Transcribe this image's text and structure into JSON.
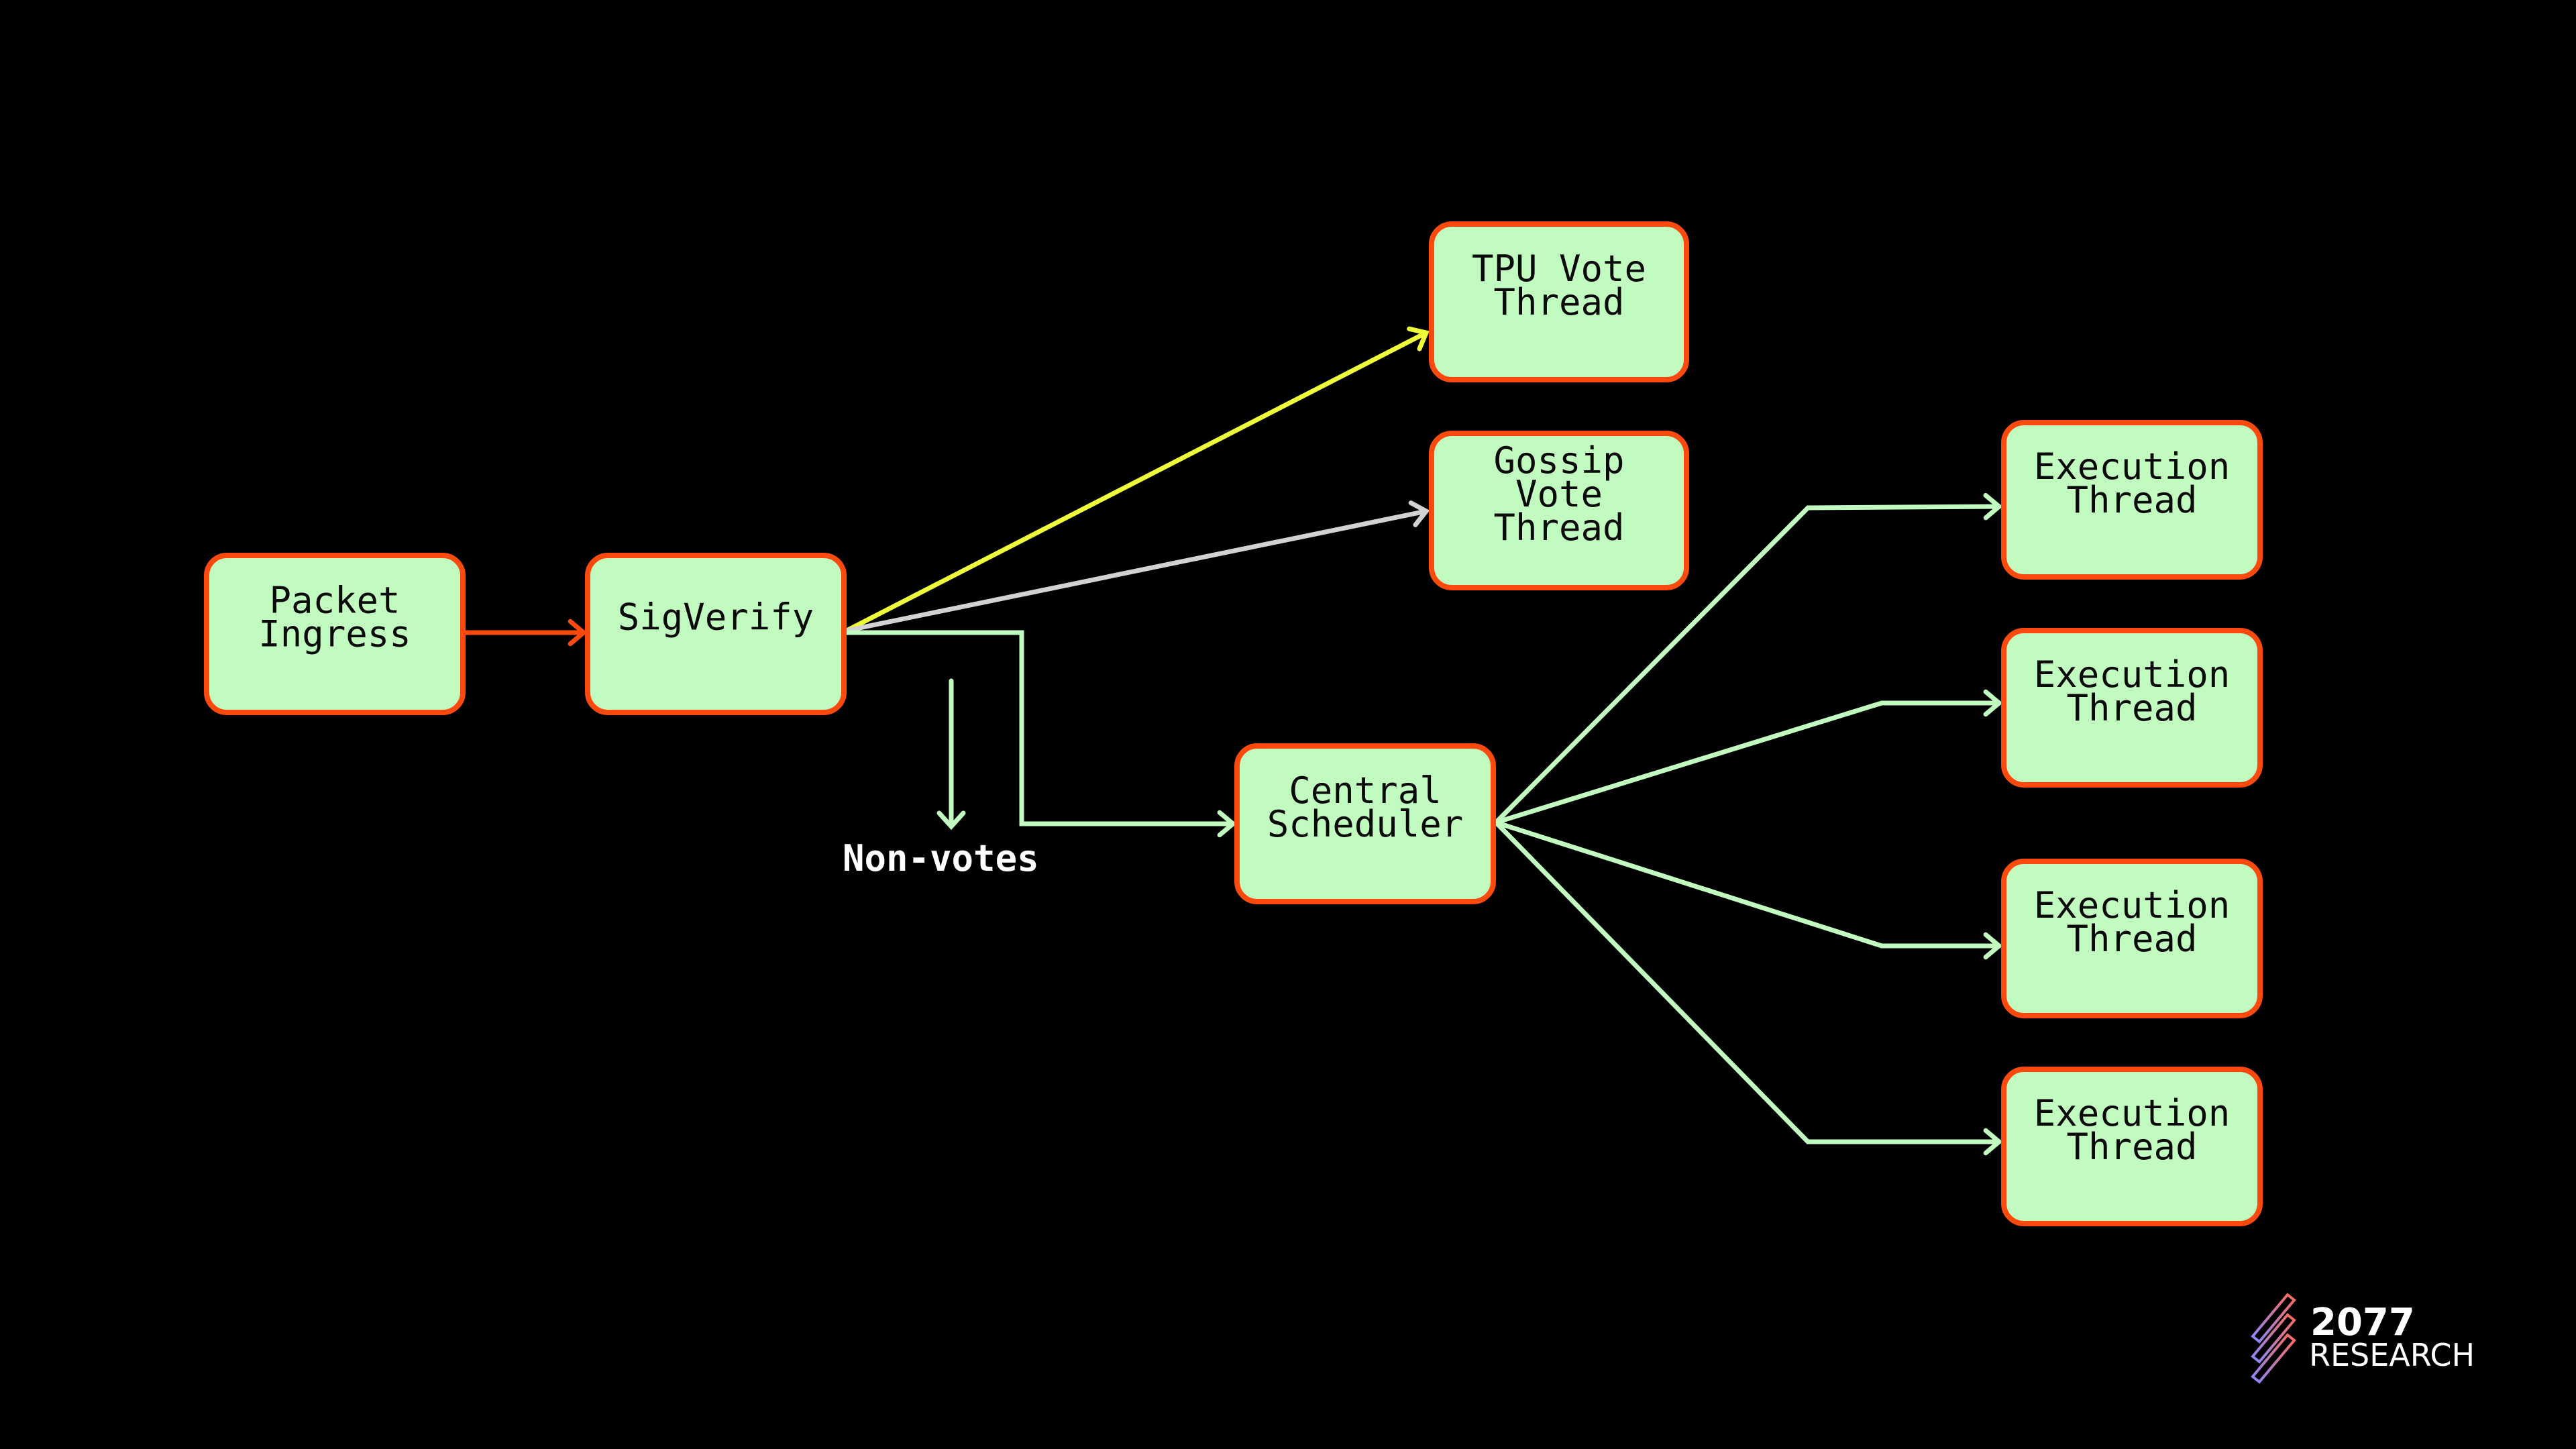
{
  "colors": {
    "background": "#000000",
    "node_fill": "#c2fbc0",
    "node_border": "#fc4a0f",
    "edge_ingress": "#fc4a0f",
    "edge_tpu_vote": "#eefc3a",
    "edge_gossip_vote": "#d2d2d2",
    "edge_default": "#c2fbc0",
    "label_text": "#ffffff"
  },
  "nodes": [
    {
      "id": "packet-ingress",
      "lines": [
        "Packet",
        "Ingress"
      ]
    },
    {
      "id": "sigverify",
      "lines": [
        "SigVerify"
      ]
    },
    {
      "id": "tpu-vote-thread",
      "lines": [
        "TPU Vote",
        "Thread"
      ]
    },
    {
      "id": "gossip-vote-thread",
      "lines": [
        "Gossip",
        "Vote",
        "Thread"
      ]
    },
    {
      "id": "central-scheduler",
      "lines": [
        "Central",
        "Scheduler"
      ]
    },
    {
      "id": "execution-thread-1",
      "lines": [
        "Execution",
        "Thread"
      ]
    },
    {
      "id": "execution-thread-2",
      "lines": [
        "Execution",
        "Thread"
      ]
    },
    {
      "id": "execution-thread-3",
      "lines": [
        "Execution",
        "Thread"
      ]
    },
    {
      "id": "execution-thread-4",
      "lines": [
        "Execution",
        "Thread"
      ]
    }
  ],
  "edges": [
    {
      "from": "packet-ingress",
      "to": "sigverify",
      "color_key": "edge_ingress"
    },
    {
      "from": "sigverify",
      "to": "tpu-vote-thread",
      "color_key": "edge_tpu_vote"
    },
    {
      "from": "sigverify",
      "to": "gossip-vote-thread",
      "color_key": "edge_gossip_vote"
    },
    {
      "from": "sigverify",
      "to": "central-scheduler",
      "color_key": "edge_default",
      "label": "Non-votes"
    },
    {
      "from": "central-scheduler",
      "to": "execution-thread-1",
      "color_key": "edge_default"
    },
    {
      "from": "central-scheduler",
      "to": "execution-thread-2",
      "color_key": "edge_default"
    },
    {
      "from": "central-scheduler",
      "to": "execution-thread-3",
      "color_key": "edge_default"
    },
    {
      "from": "central-scheduler",
      "to": "execution-thread-4",
      "color_key": "edge_default"
    }
  ],
  "annotations": {
    "non_votes_label": "Non-votes"
  },
  "logo": {
    "number": "2077",
    "word": "RESEARCH"
  }
}
